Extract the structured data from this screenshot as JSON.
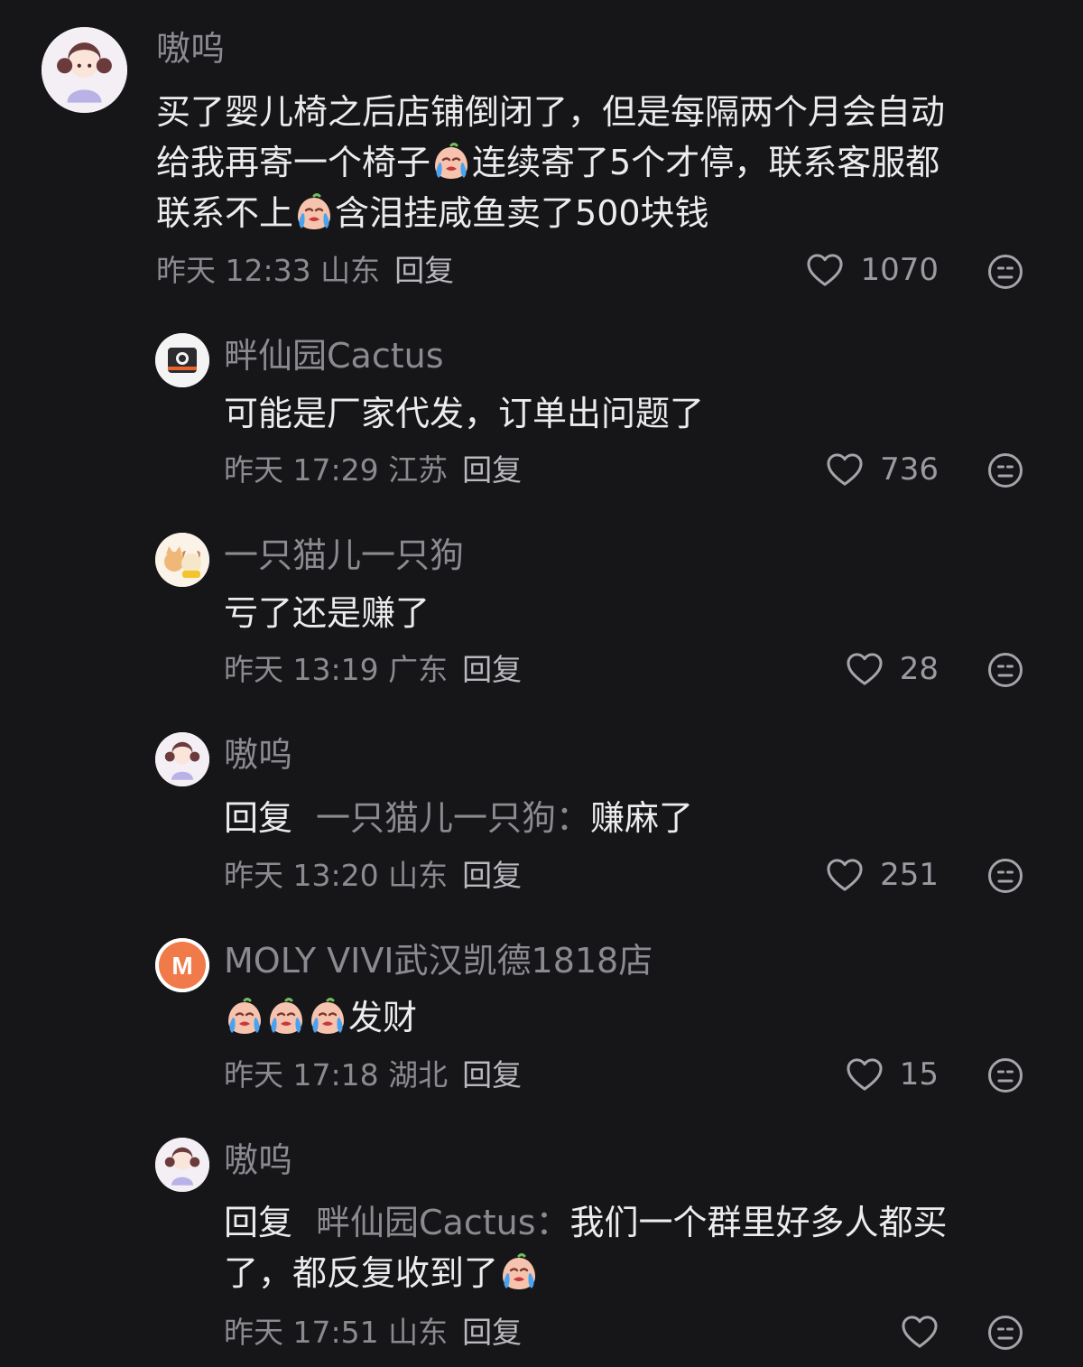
{
  "comments": [
    {
      "user": "嗷呜",
      "text_parts": [
        "买了婴儿椅之后店铺倒闭了，但是每隔两个月会自动",
        "给我再寄一个椅子",
        "连续寄了5个才停，联系客服都",
        "联系不上",
        "含泪挂咸鱼卖了500块钱"
      ],
      "time": "昨天 12:33 山东",
      "reply_label": "回复",
      "likes": "1070"
    },
    {
      "user": "畔仙园Cactus",
      "text": "可能是厂家代发，订单出问题了",
      "time": "昨天 17:29 江苏",
      "reply_label": "回复",
      "likes": "736"
    },
    {
      "user": "一只猫儿一只狗",
      "text": "亏了还是赚了",
      "time": "昨天 13:19 广东",
      "reply_label": "回复",
      "likes": "28"
    },
    {
      "user": "嗷呜",
      "reply_prefix": "回复",
      "reply_to": "一只猫儿一只狗：",
      "text": "赚麻了",
      "time": "昨天 13:20 山东",
      "reply_label": "回复",
      "likes": "251"
    },
    {
      "user": "MOLY VIVI武汉凯德1818店",
      "text": "发财",
      "time": "昨天 17:18 湖北",
      "reply_label": "回复",
      "likes": "15",
      "avatar_letter": "M"
    },
    {
      "user": "嗷呜",
      "reply_prefix": "回复",
      "reply_to": "畔仙园Cactus：",
      "text_line1": "我们一个群里好多人都买",
      "text_line2": "了，都反复收到了",
      "time": "昨天 17:51 山东",
      "reply_label": "回复"
    }
  ],
  "icons": {
    "like": "heart-outline-icon",
    "dislike": "meh-face-icon",
    "emoji": "crying-face-emoji"
  },
  "colors": {
    "background": "#161619",
    "text": "#ececef",
    "muted": "#8a8a90",
    "moly_avatar": "#f07a4a"
  }
}
